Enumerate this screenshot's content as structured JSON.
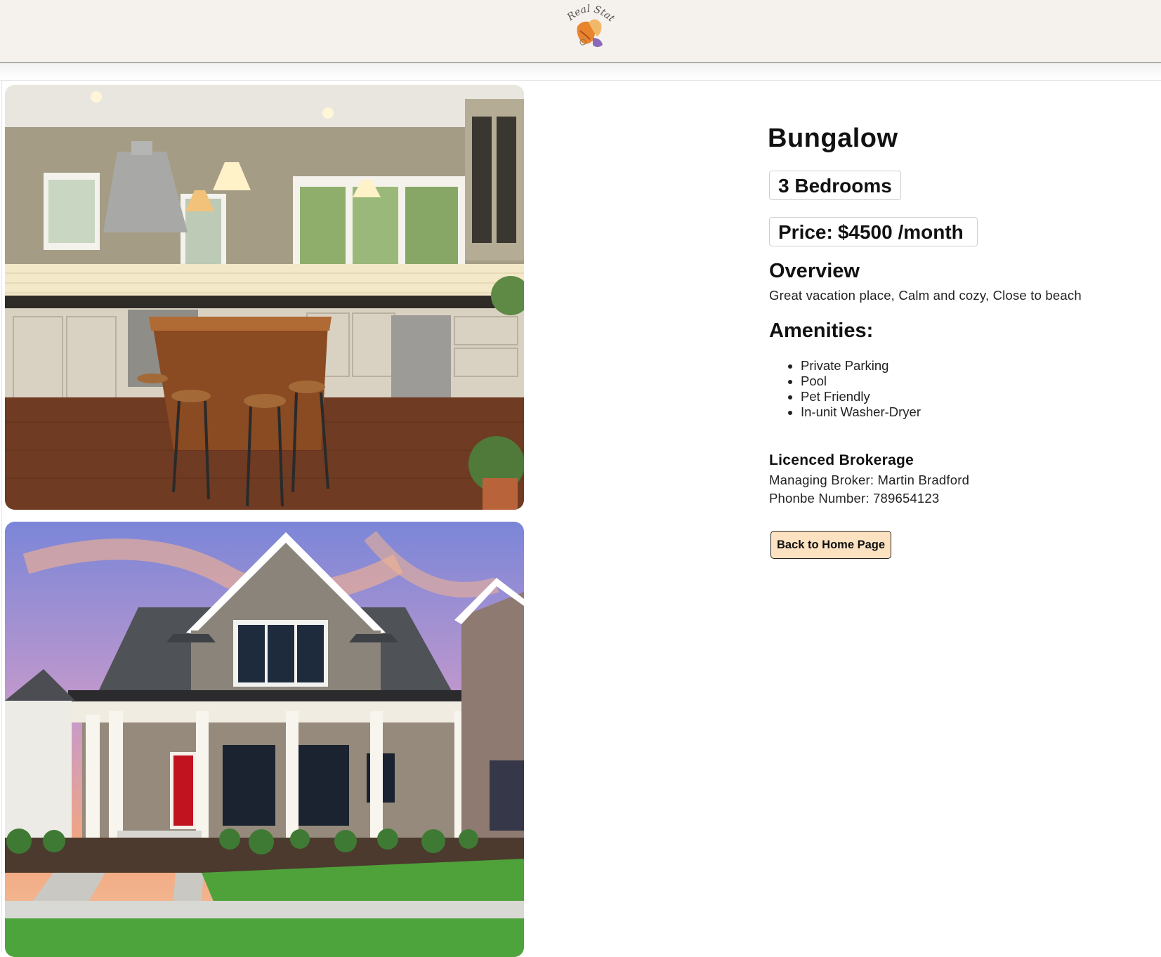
{
  "header": {
    "logo_text": "Real State"
  },
  "listing": {
    "title": "Bungalow",
    "bedrooms": "3 Bedrooms",
    "price_label": "Price:",
    "price_value": "$4500 /month",
    "overview_heading": "Overview",
    "overview_text": "Great vacation place, Calm and cozy, Close to beach",
    "amenities_heading": "Amenities:",
    "amenities": [
      "Private Parking",
      "Pool",
      "Pet Friendly",
      "In-unit Washer-Dryer"
    ],
    "broker_heading": "Licenced Brokerage",
    "broker_name": "Managing Broker: Martin Bradford",
    "broker_phone": "Phonbe Number: 789654123",
    "back_button": "Back to Home Page"
  },
  "colors": {
    "header_bg": "#f5f1ec",
    "button_bg": "#fde2c2",
    "logo_orange": "#e8842c",
    "logo_purple": "#8a6ab8"
  },
  "images": [
    {
      "subject": "kitchen-interior"
    },
    {
      "subject": "house-exterior"
    }
  ]
}
